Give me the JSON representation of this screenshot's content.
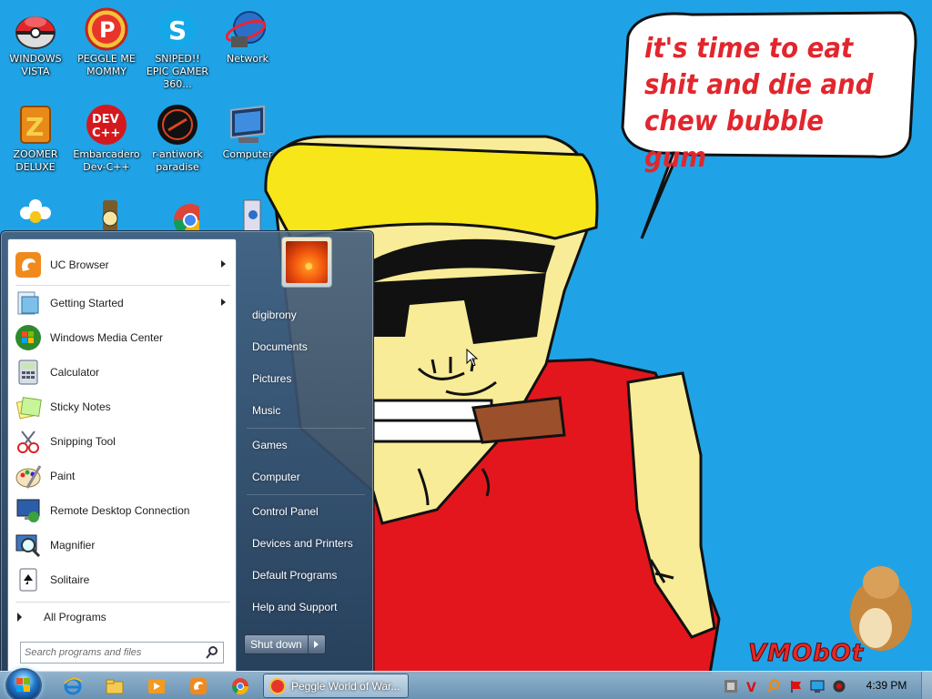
{
  "wallpaper": {
    "speech": "it's time to eat shit and die and chew bubble gum",
    "signature": "VMObOt"
  },
  "desktop_icons": [
    {
      "label": "WINDOWS VISTA",
      "icon": "pokeball-icon"
    },
    {
      "label": "PEGGLE ME MOMMY",
      "icon": "peggle-icon"
    },
    {
      "label": "SNIPED!! EPIC GAMER 360...",
      "icon": "skype-icon"
    },
    {
      "label": "Network",
      "icon": "network-icon"
    },
    {
      "label": "ZOOMER DELUXE",
      "icon": "zoomer-icon"
    },
    {
      "label": "Embarcadero Dev-C++",
      "icon": "devcpp-icon"
    },
    {
      "label": "r-antiwork paradise",
      "icon": "antiwork-icon"
    },
    {
      "label": "Computer",
      "icon": "computer-icon"
    }
  ],
  "start_menu": {
    "programs": [
      {
        "label": "UC Browser",
        "submenu": true
      },
      {
        "label": "Getting Started",
        "submenu": true
      },
      {
        "label": "Windows Media Center",
        "submenu": false
      },
      {
        "label": "Calculator",
        "submenu": false
      },
      {
        "label": "Sticky Notes",
        "submenu": false
      },
      {
        "label": "Snipping Tool",
        "submenu": false
      },
      {
        "label": "Paint",
        "submenu": false
      },
      {
        "label": "Remote Desktop Connection",
        "submenu": false
      },
      {
        "label": "Magnifier",
        "submenu": false
      },
      {
        "label": "Solitaire",
        "submenu": false
      }
    ],
    "all_programs": "All Programs",
    "search_placeholder": "Search programs and files",
    "right_links": {
      "user": "digibrony",
      "documents": "Documents",
      "pictures": "Pictures",
      "music": "Music",
      "games": "Games",
      "computer": "Computer",
      "control_panel": "Control Panel",
      "devices": "Devices and Printers",
      "default_programs": "Default Programs",
      "help": "Help and Support"
    },
    "shutdown": "Shut down"
  },
  "taskbar": {
    "task_title": "Peggle World of War...",
    "clock": "4:39 PM"
  }
}
